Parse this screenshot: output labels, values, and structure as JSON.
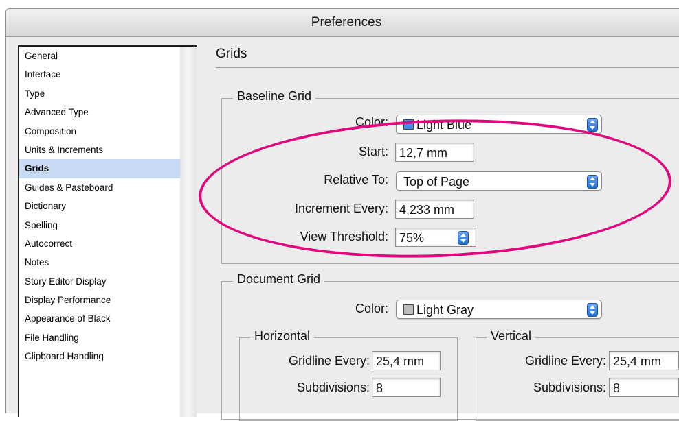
{
  "window": {
    "title": "Preferences"
  },
  "sidebar": {
    "items": [
      {
        "label": "General"
      },
      {
        "label": "Interface"
      },
      {
        "label": "Type"
      },
      {
        "label": "Advanced Type"
      },
      {
        "label": "Composition"
      },
      {
        "label": "Units & Increments"
      },
      {
        "label": "Grids",
        "selected": true
      },
      {
        "label": "Guides & Pasteboard"
      },
      {
        "label": "Dictionary"
      },
      {
        "label": "Spelling"
      },
      {
        "label": "Autocorrect"
      },
      {
        "label": "Notes"
      },
      {
        "label": "Story Editor Display"
      },
      {
        "label": "Display Performance"
      },
      {
        "label": "Appearance of Black"
      },
      {
        "label": "File Handling"
      },
      {
        "label": "Clipboard Handling"
      }
    ]
  },
  "section": {
    "title": "Grids"
  },
  "baseline_grid": {
    "title": "Baseline Grid",
    "color_label": "Color:",
    "color_value": "Light Blue",
    "color_swatch": "#3d8ef0",
    "start_label": "Start:",
    "start_value": "12,7 mm",
    "relative_label": "Relative To:",
    "relative_value": "Top of Page",
    "increment_label": "Increment Every:",
    "increment_value": "4,233 mm",
    "threshold_label": "View Threshold:",
    "threshold_value": "75%"
  },
  "document_grid": {
    "title": "Document Grid",
    "color_label": "Color:",
    "color_value": "Light Gray",
    "color_swatch": "#bdbdbd",
    "horizontal": {
      "title": "Horizontal",
      "gridline_label": "Gridline Every:",
      "gridline_value": "25,4 mm",
      "subdivisions_label": "Subdivisions:",
      "subdivisions_value": "8"
    },
    "vertical": {
      "title": "Vertical",
      "gridline_label": "Gridline Every:",
      "gridline_value": "25,4 mm",
      "subdivisions_label": "Subdivisions:",
      "subdivisions_value": "8"
    }
  },
  "annotation": {
    "color": "#e0087c"
  }
}
